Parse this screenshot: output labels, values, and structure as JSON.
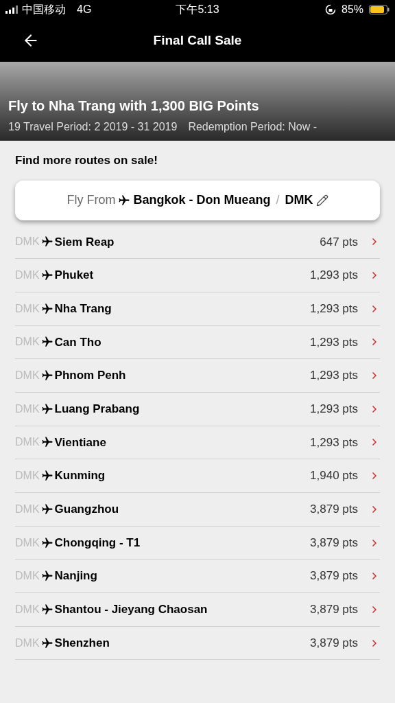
{
  "status_bar": {
    "carrier": "中国移动",
    "network": "4G",
    "time": "下午5:13",
    "battery": "85%"
  },
  "nav": {
    "title": "Final Call Sale"
  },
  "banner": {
    "headline": "Fly to Nha Trang with  1,300 BIG Points",
    "travel_period": "19 Travel Period: 2  2019 - 31  2019",
    "redemption_period": "Redemption Period: Now -"
  },
  "section_title": "Find more routes on sale!",
  "fly_from": {
    "label": "Fly From",
    "airport": "Bangkok - Don Mueang",
    "separator": "/",
    "code": "DMK"
  },
  "routes": [
    {
      "origin": "DMK",
      "destination": "Siem Reap",
      "points": "647 pts"
    },
    {
      "origin": "DMK",
      "destination": "Phuket",
      "points": "1,293 pts"
    },
    {
      "origin": "DMK",
      "destination": "Nha Trang",
      "points": "1,293 pts"
    },
    {
      "origin": "DMK",
      "destination": "Can Tho",
      "points": "1,293 pts"
    },
    {
      "origin": "DMK",
      "destination": "Phnom Penh",
      "points": "1,293 pts"
    },
    {
      "origin": "DMK",
      "destination": "Luang Prabang",
      "points": "1,293 pts"
    },
    {
      "origin": "DMK",
      "destination": "Vientiane",
      "points": "1,293 pts"
    },
    {
      "origin": "DMK",
      "destination": "Kunming",
      "points": "1,940 pts"
    },
    {
      "origin": "DMK",
      "destination": "Guangzhou",
      "points": "3,879 pts"
    },
    {
      "origin": "DMK",
      "destination": "Chongqing - T1",
      "points": "3,879 pts"
    },
    {
      "origin": "DMK",
      "destination": "Nanjing",
      "points": "3,879 pts"
    },
    {
      "origin": "DMK",
      "destination": "Shantou - Jieyang Chaosan",
      "points": "3,879 pts"
    },
    {
      "origin": "DMK",
      "destination": "Shenzhen",
      "points": "3,879 pts"
    }
  ]
}
